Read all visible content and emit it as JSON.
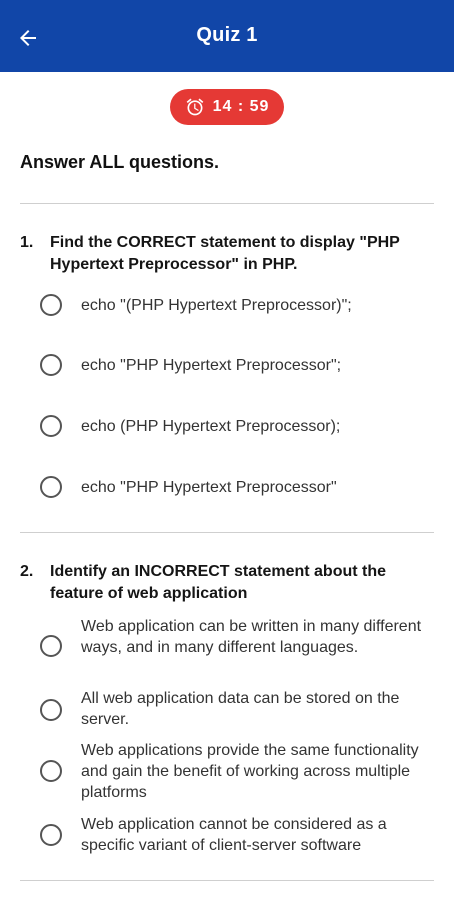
{
  "appbar": {
    "title": "Quiz 1"
  },
  "timer": {
    "value": "14 : 59"
  },
  "instruction": "Answer ALL questions.",
  "questions": [
    {
      "number": "1.",
      "text": "Find the CORRECT statement to display \"PHP Hypertext Preprocessor\" in PHP.",
      "options": [
        "echo \"(PHP Hypertext Preprocessor)\";",
        "echo \"PHP Hypertext Preprocessor\";",
        "echo (PHP Hypertext Preprocessor);",
        "echo \"PHP Hypertext Preprocessor\""
      ]
    },
    {
      "number": "2.",
      "text": "Identify an INCORRECT statement about the feature of web application",
      "options": [
        "Web application can be written in many different ways, and in many different languages.",
        "All web application data can be stored on the server.",
        "Web applications provide the same functionality and gain the benefit of working across multiple platforms",
        "Web application cannot be considered as a specific variant of client-server software"
      ]
    }
  ]
}
